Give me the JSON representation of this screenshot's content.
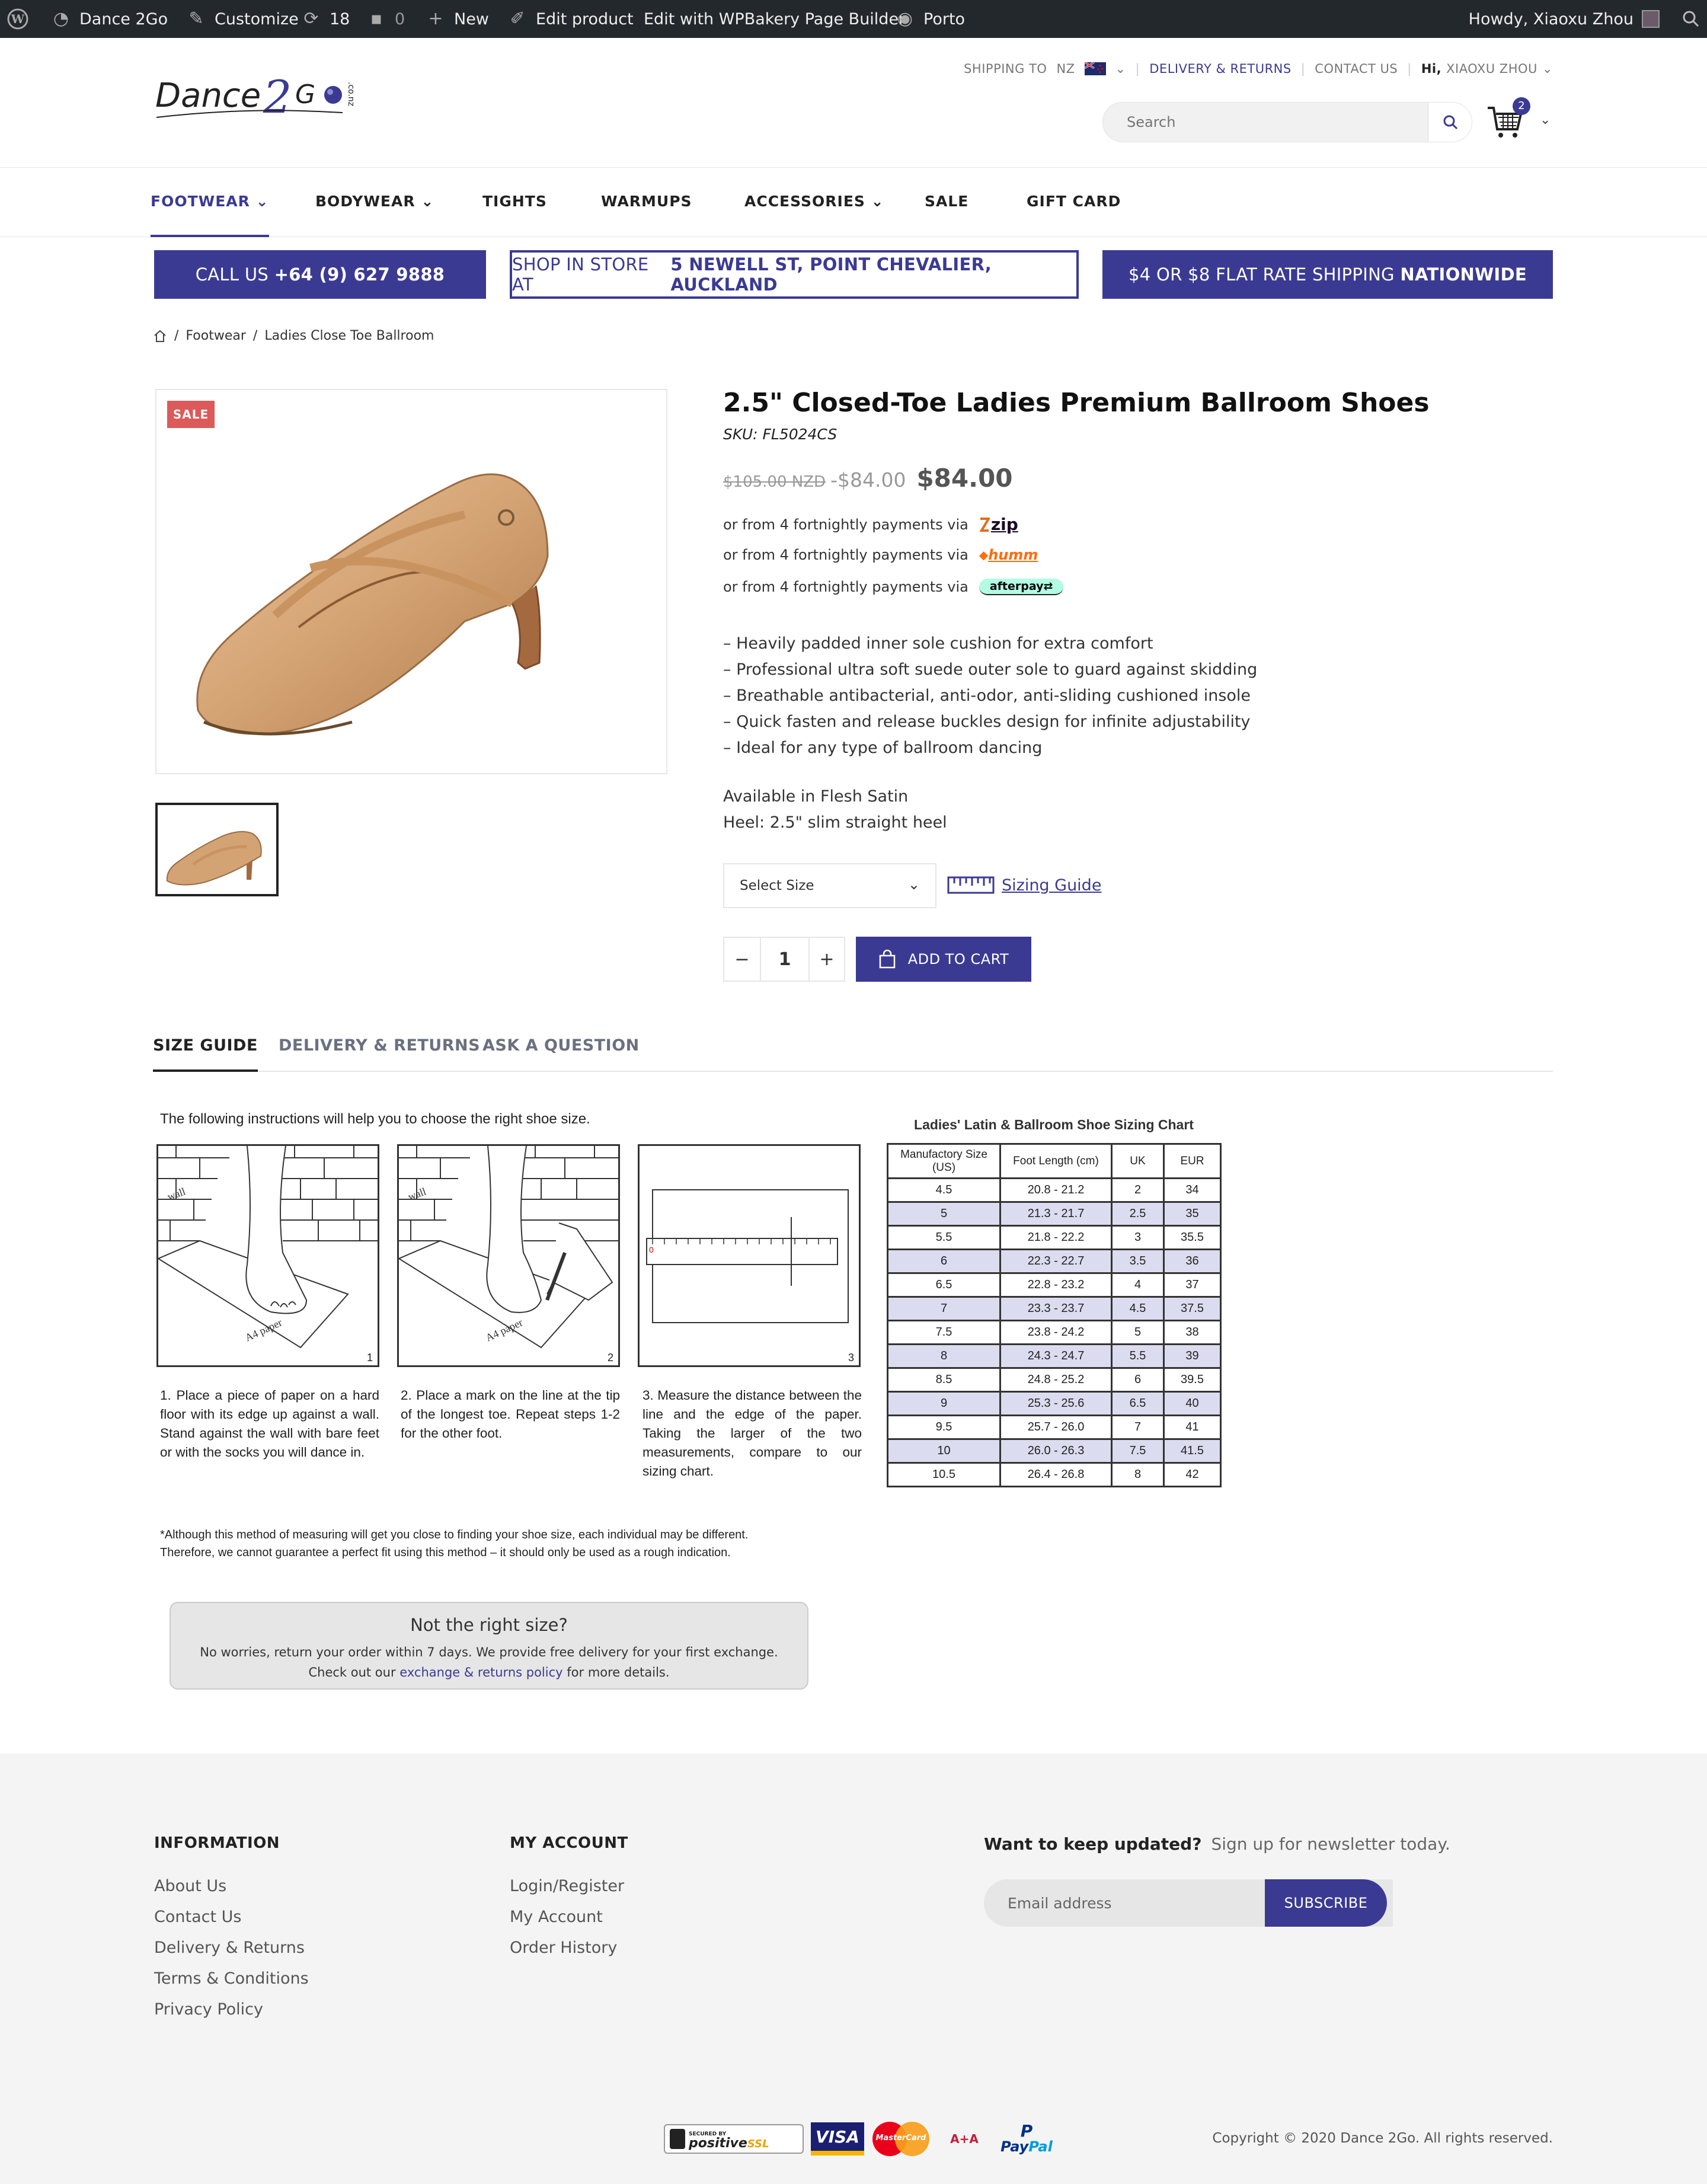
{
  "adminbar": {
    "site": "Dance 2Go",
    "customize": "Customize",
    "updates": "18",
    "comments": "0",
    "new": "New",
    "edit_product": "Edit product",
    "wpbakery": "Edit with WPBakery Page Builder",
    "theme": "Porto",
    "howdy": "Howdy, Xiaoxu Zhou"
  },
  "header": {
    "shipping_label": "SHIPPING TO",
    "shipping_country": "NZ",
    "delivery": "DELIVERY & RETURNS",
    "contact": "CONTACT US",
    "hi": "Hi,",
    "user": "XIAOXU ZHOU",
    "search_placeholder": "Search",
    "cart_count": "2",
    "logo_text": "Dance",
    "logo_num": "2",
    "logo_go": "G",
    "logo_suffix": ".co.nz"
  },
  "nav": [
    "FOOTWEAR",
    "BODYWEAR",
    "TIGHTS",
    "WARMUPS",
    "ACCESSORIES",
    "SALE",
    "GIFT CARD"
  ],
  "promo": {
    "call_prefix": "CALL US",
    "call_number": "+64 (9) 627 9888",
    "shop_prefix": "SHOP IN STORE AT",
    "shop_address": "5 NEWELL ST, POINT CHEVALIER, AUCKLAND",
    "ship_prefix": "$4 OR $8 FLAT RATE SHIPPING",
    "ship_suffix": "NATIONWIDE"
  },
  "breadcrumb": [
    "Footwear",
    "Ladies Close Toe Ballroom"
  ],
  "product": {
    "sale_badge": "SALE",
    "title": "2.5\" Closed-Toe Ladies Premium Ballroom Shoes",
    "sku": "SKU: FL5024CS",
    "price_old": "$105.00 NZD",
    "price_old2": "-$84.00",
    "price_new": "$84.00",
    "pay_text": "or from 4 fortnightly payments via",
    "pay_zip": "zip",
    "pay_humm": "humm",
    "pay_afterpay": "afterpay",
    "features": [
      "– Heavily padded inner sole cushion for extra comfort",
      "– Professional ultra soft suede outer sole to guard against skidding",
      "– Breathable antibacterial, anti-odor, anti-sliding cushioned insole",
      "– Quick fasten and release buckles design for infinite adjustability",
      "– Ideal for any type of ballroom dancing"
    ],
    "available": "Available in Flesh Satin",
    "heel": "Heel: 2.5\" slim straight heel",
    "select_size": "Select Size",
    "sizing_guide": "Sizing Guide",
    "qty": "1",
    "add_to_cart": "ADD TO CART"
  },
  "tabs": [
    "SIZE GUIDE",
    "DELIVERY & RETURNS",
    "ASK A QUESTION"
  ],
  "size_guide": {
    "intro": "The following instructions will help you to choose the right shoe size.",
    "wall": "wall",
    "paper": "A4 paper",
    "steps": [
      "1. Place a piece of paper on a hard floor with its edge up against a wall. Stand against the wall with bare feet or with the socks you will dance in.",
      "2. Place a mark on the line at the tip of the longest toe. Repeat steps 1-2 for the other foot.",
      "3. Measure the distance between the line and the edge of the paper. Taking the larger of the two measurements, compare to our sizing chart."
    ],
    "step_nums": [
      "1",
      "2",
      "3"
    ],
    "disclaimer_1": "*Although this method of measuring will get you close to finding your shoe size, each individual may be different.",
    "disclaimer_2": "Therefore, we cannot guarantee a perfect fit using this method – it should only be used as a rough indication.",
    "chart_title": "Ladies' Latin & Ballroom Shoe Sizing Chart",
    "headers": [
      "Manufactory Size (US)",
      "Foot Length (cm)",
      "UK",
      "EUR"
    ],
    "rows": [
      [
        "4.5",
        "20.8 - 21.2",
        "2",
        "34"
      ],
      [
        "5",
        "21.3 - 21.7",
        "2.5",
        "35"
      ],
      [
        "5.5",
        "21.8 - 22.2",
        "3",
        "35.5"
      ],
      [
        "6",
        "22.3 - 22.7",
        "3.5",
        "36"
      ],
      [
        "6.5",
        "22.8 - 23.2",
        "4",
        "37"
      ],
      [
        "7",
        "23.3 - 23.7",
        "4.5",
        "37.5"
      ],
      [
        "7.5",
        "23.8 - 24.2",
        "5",
        "38"
      ],
      [
        "8",
        "24.3 - 24.7",
        "5.5",
        "39"
      ],
      [
        "8.5",
        "24.8 - 25.2",
        "6",
        "39.5"
      ],
      [
        "9",
        "25.3 - 25.6",
        "6.5",
        "40"
      ],
      [
        "9.5",
        "25.7 - 26.0",
        "7",
        "41"
      ],
      [
        "10",
        "26.0 - 26.3",
        "7.5",
        "41.5"
      ],
      [
        "10.5",
        "26.4 - 26.8",
        "8",
        "42"
      ]
    ],
    "not_right_title": "Not the right size?",
    "not_right_line1": "No worries, return your order within 7 days. We provide free delivery for your first exchange.",
    "not_right_pre": "Check out our",
    "not_right_link": "exchange & returns policy",
    "not_right_post": "for more details."
  },
  "footer": {
    "info_title": "INFORMATION",
    "info_links": [
      "About Us",
      "Contact Us",
      "Delivery & Returns",
      "Terms & Conditions",
      "Privacy Policy"
    ],
    "account_title": "MY ACCOUNT",
    "account_links": [
      "Login/Register",
      "My Account",
      "Order History"
    ],
    "news_title": "Want to keep updated?",
    "news_sub": "Sign up for newsletter today.",
    "email_placeholder": "Email address",
    "subscribe": "SUBSCRIBE",
    "ssl_secured": "SECURED BY",
    "ssl_positive": "positive",
    "ssl_ssl": "SSL",
    "visa": "VISA",
    "mastercard": "MasterCard",
    "aa": "A+A",
    "paypal_pay": "Pay",
    "paypal_pal": "Pal",
    "copyright": "Copyright © 2020 Dance 2Go. All rights reserved."
  },
  "colors": {
    "accent": "#3b3a93",
    "sale": "#dc5a5a",
    "adminbar": "#23282d",
    "table_alt": "#dcdcf0"
  }
}
